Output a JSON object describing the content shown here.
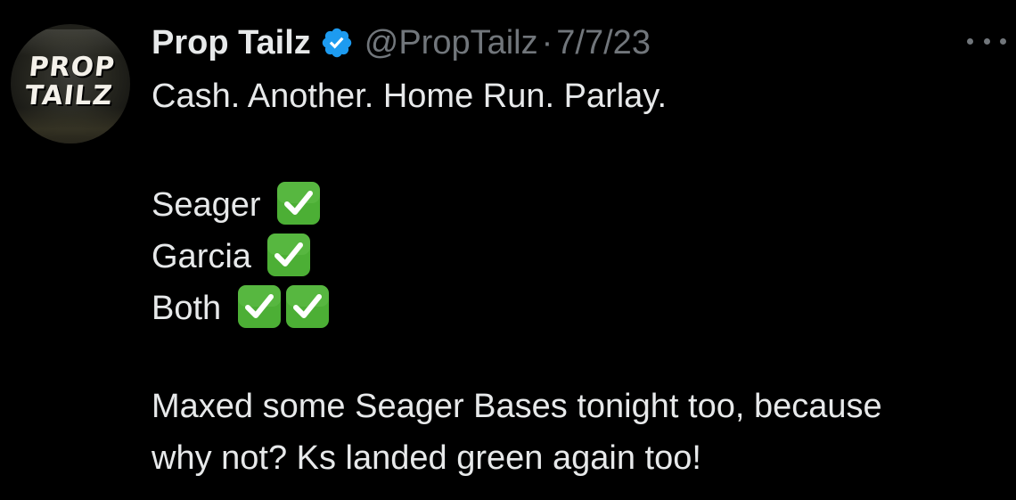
{
  "author": {
    "display_name": "Prop Tailz",
    "handle": "@PropTailz",
    "separator": "·",
    "date": "7/7/23",
    "avatar_logo_line1": "PROP",
    "avatar_logo_line2": "TAILZ",
    "verified_icon": "verified-badge-icon"
  },
  "tweet": {
    "line1": "Cash. Another. Home Run. Parlay.",
    "line2": "Seager",
    "line3": "Garcia",
    "line4": "Both",
    "line5": "Maxed some Seager Bases tonight too, because",
    "line6": "why not? Ks landed green again too!",
    "emoji_icon": "check-mark-button-icon"
  },
  "more_icon": "more-options-icon",
  "colors": {
    "background": "#000000",
    "primary_text": "#e7e9ea",
    "secondary_text": "#71767b",
    "verified_blue": "#1d9bf0",
    "check_green": "#4caf35"
  }
}
